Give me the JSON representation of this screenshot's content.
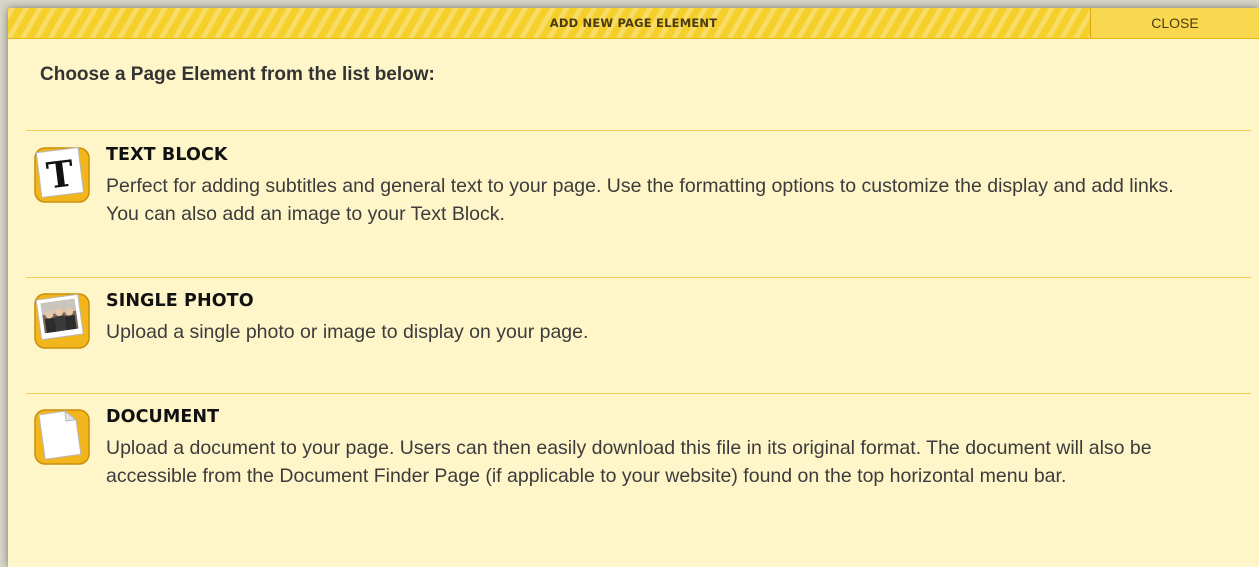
{
  "dialog": {
    "title": "ADD NEW PAGE ELEMENT",
    "close_label": "CLOSE",
    "intro": "Choose a Page Element from the list below:"
  },
  "colors": {
    "background": "#fef5c9",
    "titlebar": "#f5cf2a",
    "divider": "#f1cf55",
    "icon_frame": "#f2b61c"
  },
  "elements": [
    {
      "icon": "text-block-icon",
      "title": "TEXT BLOCK",
      "description": "Perfect for adding subtitles and general text to your page. Use the formatting options to customize the display and add links. You can also add an image to your Text Block."
    },
    {
      "icon": "photo-icon",
      "title": "SINGLE PHOTO",
      "description": "Upload a single photo or image to display on your page."
    },
    {
      "icon": "document-icon",
      "title": "DOCUMENT",
      "description": "Upload a document to your page. Users can then easily download this file in its original format. The document will also be accessible from the Document Finder Page (if applicable to your website) found on the top horizontal menu bar."
    }
  ]
}
